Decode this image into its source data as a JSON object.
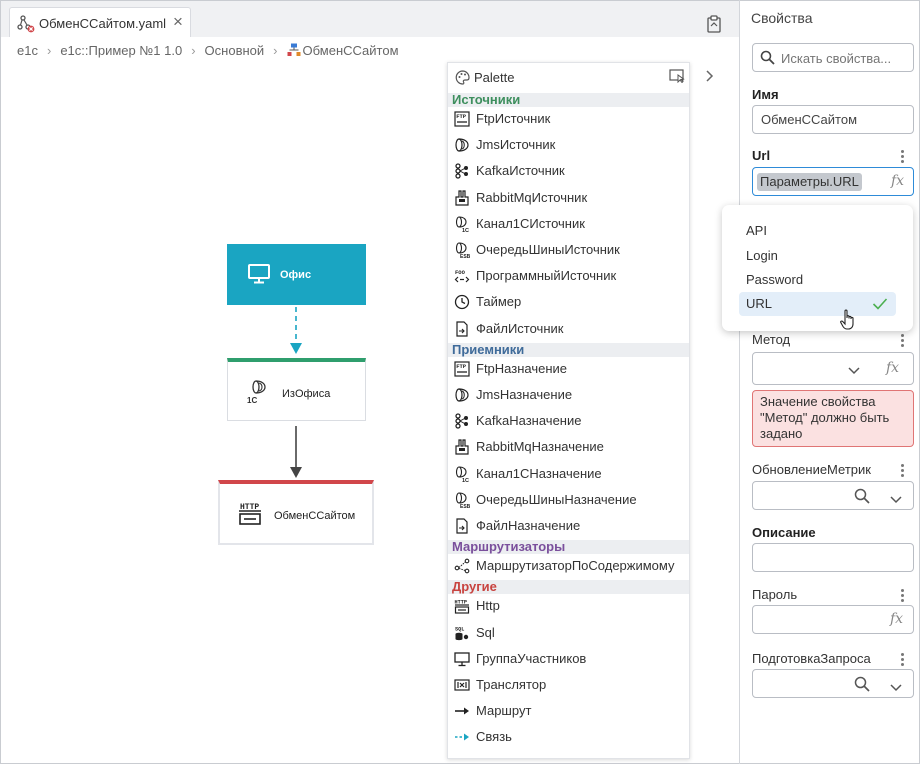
{
  "tab": {
    "title": "ОбменССайтом.yaml",
    "close_label": "×"
  },
  "breadcrumb": {
    "items": [
      "e1c",
      "e1c::Пример №1 1.0",
      "Основной",
      "ОбменССайтом"
    ],
    "separator": "›"
  },
  "diagram": {
    "nodes": [
      {
        "label": "Офис",
        "color": "#1aa5c2"
      },
      {
        "label": "ИзОфиса",
        "accent": "#2f9e6d"
      },
      {
        "label": "ОбменССайтом",
        "accent": "#d1464a"
      }
    ]
  },
  "palette": {
    "title": "Palette",
    "sections": [
      {
        "title": "Источники",
        "color": "#3e8f5e",
        "items": [
          {
            "label": "FtpИсточник",
            "icon": "ftp-icon"
          },
          {
            "label": "JmsИсточник",
            "icon": "jms-icon"
          },
          {
            "label": "KafkaИсточник",
            "icon": "kafka-icon"
          },
          {
            "label": "RabbitMqИсточник",
            "icon": "rabbitmq-icon"
          },
          {
            "label": "Канал1СИсточник",
            "icon": "channel-1c-icon"
          },
          {
            "label": "ОчередьШиныИсточник",
            "icon": "esb-queue-icon"
          },
          {
            "label": "ПрограммныйИсточник",
            "icon": "code-icon"
          },
          {
            "label": "Таймер",
            "icon": "clock-icon"
          },
          {
            "label": "ФайлИсточник",
            "icon": "file-icon"
          }
        ]
      },
      {
        "title": "Приемники",
        "color": "#3f6b9a",
        "items": [
          {
            "label": "FtpНазначение",
            "icon": "ftp-icon"
          },
          {
            "label": "JmsНазначение",
            "icon": "jms-icon"
          },
          {
            "label": "KafkaНазначение",
            "icon": "kafka-icon"
          },
          {
            "label": "RabbitMqНазначение",
            "icon": "rabbitmq-icon"
          },
          {
            "label": "Канал1СНазначение",
            "icon": "channel-1c-icon"
          },
          {
            "label": "ОчередьШиныНазначение",
            "icon": "esb-queue-icon"
          },
          {
            "label": "ФайлНазначение",
            "icon": "file-icon"
          }
        ]
      },
      {
        "title": "Маршрутизаторы",
        "color": "#7a4f9c",
        "items": [
          {
            "label": "МаршрутизаторПоСодержимому",
            "icon": "router-icon"
          }
        ]
      },
      {
        "title": "Другие",
        "color": "#c8433f",
        "items": [
          {
            "label": "Http",
            "icon": "http-icon"
          },
          {
            "label": "Sql",
            "icon": "sql-icon"
          },
          {
            "label": "ГруппаУчастников",
            "icon": "monitor-icon"
          },
          {
            "label": "Транслятор",
            "icon": "translator-icon"
          },
          {
            "label": "Маршрут",
            "icon": "arrow-right-icon"
          },
          {
            "label": "Связь",
            "icon": "dashed-arrow-icon"
          }
        ]
      }
    ]
  },
  "properties": {
    "title": "Свойства",
    "search_placeholder": "Искать свойства...",
    "name_label": "Имя",
    "name_value": "ОбменССайтом",
    "url_label": "Url",
    "url_value": "Параметры.URL",
    "fx_label": "fx",
    "method_label": "Метод",
    "error_text": "Значение свойства \"Метод\" должно быть задано",
    "metrics_label": "ОбновлениеМетрик",
    "description_label": "Описание",
    "password_label": "Пароль",
    "request_prep_label": "ПодготовкаЗапроса"
  },
  "dropdown": {
    "items": [
      "API",
      "Login",
      "Password",
      "URL"
    ],
    "selected": "URL"
  },
  "colors": {
    "accent": "#1aa5c2",
    "check": "#4caf50"
  }
}
